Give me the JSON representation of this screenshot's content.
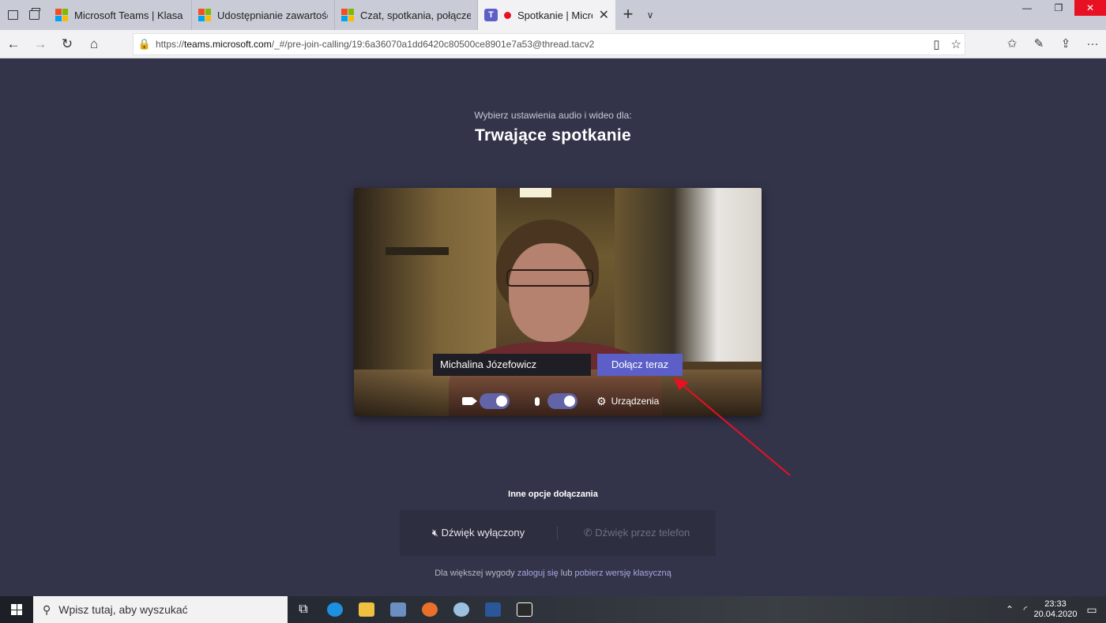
{
  "browser": {
    "tabs": [
      {
        "label": "Microsoft Teams | Klasa onli",
        "icon": "microsoft-icon"
      },
      {
        "label": "Udostępnianie zawartości p",
        "icon": "microsoft-icon"
      },
      {
        "label": "Czat, spotkania, połączenia,",
        "icon": "microsoft-icon"
      },
      {
        "label": "Spotkanie | Microsc",
        "icon": "teams-icon",
        "active": true
      }
    ],
    "new_tab": "+",
    "tab_dropdown": "∨",
    "url_prefix": "https://",
    "url_domain": "teams.microsoft.com",
    "url_rest": "/_#/pre-join-calling/19:6a36070a1dd6420c80500ce8901e7a53@thread.tacv2"
  },
  "meeting": {
    "subtitle": "Wybierz ustawienia audio i wideo dla:",
    "title": "Trwające spotkanie",
    "name": "Michalina Józefowicz",
    "join_label": "Dołącz teraz",
    "camera_on": true,
    "mic_on": true,
    "devices_label": "Urządzenia"
  },
  "other": {
    "title": "Inne opcje dołączania",
    "audio_off": "Dźwięk wyłączony",
    "phone_audio": "Dźwięk przez telefon",
    "note_prefix": "Dla większej wygody ",
    "note_login": "zaloguj się",
    "note_mid": " lub ",
    "note_download": "pobierz wersję klasyczną"
  },
  "taskbar": {
    "search_placeholder": "Wpisz tutaj, aby wyszukać",
    "time": "23:33",
    "date": "20.04.2020"
  },
  "colors": {
    "background": "#33344a",
    "accent": "#5b5fc7",
    "toggle": "#6264a7",
    "annotation_arrow": "#e81123"
  }
}
